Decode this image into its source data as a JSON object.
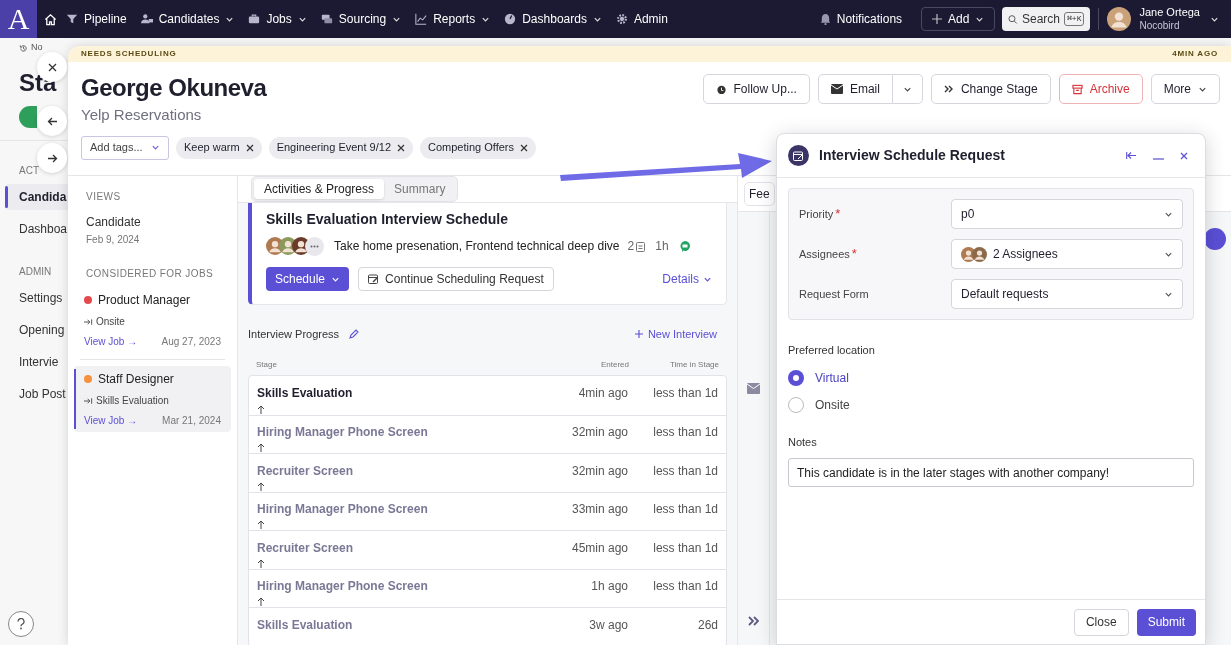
{
  "top_nav": {
    "logo": "A",
    "items": [
      {
        "label": "Pipeline",
        "has_menu": false
      },
      {
        "label": "Candidates",
        "has_menu": true
      },
      {
        "label": "Jobs",
        "has_menu": true
      },
      {
        "label": "Sourcing",
        "has_menu": true
      },
      {
        "label": "Reports",
        "has_menu": true
      },
      {
        "label": "Dashboards",
        "has_menu": true
      },
      {
        "label": "Admin",
        "has_menu": false
      }
    ],
    "notifications": "Notifications",
    "add_button": "Add",
    "search": {
      "label": "Search",
      "shortcut": "⌘+K"
    },
    "user": {
      "name": "Jane Ortega",
      "company": "Nocobird"
    }
  },
  "background_page": {
    "history": "No",
    "title": "Sta",
    "sections": [
      {
        "heading": "ACT",
        "items": [
          {
            "label": "Candida",
            "selected": true
          },
          {
            "label": "Dashboa",
            "selected": false
          }
        ]
      },
      {
        "heading": "ADMIN",
        "items": [
          {
            "label": "Settings",
            "selected": false
          },
          {
            "label": "Opening",
            "selected": false
          },
          {
            "label": "Intervie",
            "selected": false
          },
          {
            "label": "Job Post",
            "selected": false
          }
        ]
      }
    ]
  },
  "candidate_drawer": {
    "banner": {
      "status": "NEEDS SCHEDULING",
      "time": "4MIN AGO"
    },
    "name": "George Okuneva",
    "company": "Yelp Reservations",
    "add_tags_placeholder": "Add tags...",
    "tags": [
      "Keep warm",
      "Engineering Event 9/12",
      "Competing Offers"
    ],
    "actions": [
      {
        "label": "Follow Up...",
        "kind": "followup"
      },
      {
        "label": "Email",
        "kind": "split"
      },
      {
        "label": "Change Stage",
        "kind": "stage"
      },
      {
        "label": "Archive",
        "kind": "danger"
      },
      {
        "label": "More",
        "kind": "menu"
      }
    ],
    "views": {
      "heading": "VIEWS",
      "items": [
        {
          "label": "Candidate",
          "date": "Feb 9, 2024"
        }
      ]
    },
    "jobs": {
      "heading": "CONSIDERED FOR JOBS",
      "items": [
        {
          "title": "Product Manager",
          "color": "#e5484d",
          "stage": "Onsite",
          "link": "View Job →",
          "date": "Aug 27, 2023",
          "selected": false
        },
        {
          "title": "Staff Designer",
          "color": "#f5903d",
          "stage": "Skills Evaluation",
          "link": "View Job →",
          "date": "Mar 21, 2024",
          "selected": true
        }
      ]
    },
    "tabs": [
      {
        "label": "Activities & Progress",
        "selected": true
      },
      {
        "label": "Summary",
        "selected": false
      }
    ],
    "side_tab": "Fee",
    "schedule_card": {
      "title": "Skills Evaluation Interview Schedule",
      "interviews": "Take home presenation, Frontend technical deep dive",
      "count": "2",
      "duration": "1h",
      "schedule_button": "Schedule",
      "continue_button": "Continue Scheduling Request",
      "details_link": "Details"
    },
    "interview_progress": {
      "title": "Interview Progress",
      "new_link": "New Interview",
      "columns": [
        "Stage",
        "Entered",
        "Time in Stage"
      ],
      "rows": [
        {
          "stage": "Skills Evaluation",
          "entered": "4min ago",
          "time": "less than 1d",
          "current": true
        },
        {
          "stage": "Hiring Manager Phone Screen",
          "entered": "32min ago",
          "time": "less than 1d",
          "current": false
        },
        {
          "stage": "Recruiter Screen",
          "entered": "32min ago",
          "time": "less than 1d",
          "current": false
        },
        {
          "stage": "Hiring Manager Phone Screen",
          "entered": "33min ago",
          "time": "less than 1d",
          "current": false
        },
        {
          "stage": "Recruiter Screen",
          "entered": "45min ago",
          "time": "less than 1d",
          "current": false
        },
        {
          "stage": "Hiring Manager Phone Screen",
          "entered": "1h ago",
          "time": "less than 1d",
          "current": false
        },
        {
          "stage": "Skills Evaluation",
          "entered": "3w ago",
          "time": "26d",
          "current": false
        }
      ]
    }
  },
  "schedule_request_panel": {
    "title": "Interview Schedule Request",
    "required_mark": "*",
    "fields": [
      {
        "label": "Priority",
        "required": true,
        "value": "p0",
        "kind": "select"
      },
      {
        "label": "Assignees",
        "required": true,
        "value": "2 Assignees",
        "kind": "assignees"
      },
      {
        "label": "Request Form",
        "required": false,
        "value": "Default requests",
        "kind": "select"
      }
    ],
    "location": {
      "label": "Preferred location",
      "options": [
        {
          "label": "Virtual",
          "selected": true
        },
        {
          "label": "Onsite",
          "selected": false
        }
      ]
    },
    "notes": {
      "label": "Notes",
      "value": "This candidate is in the later stages with another company!"
    },
    "buttons": [
      {
        "label": "Close",
        "kind": "secondary"
      },
      {
        "label": "Submit",
        "kind": "primary"
      }
    ]
  }
}
